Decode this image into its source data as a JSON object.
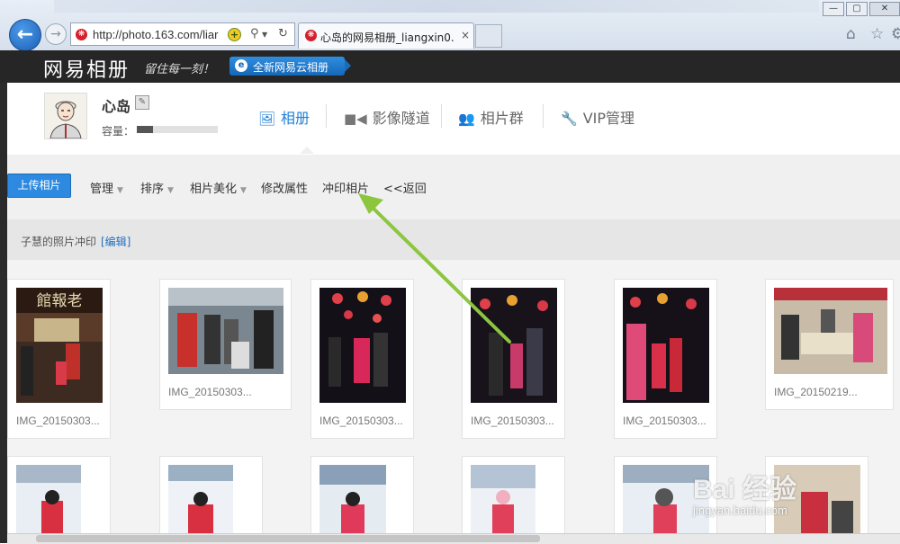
{
  "browser": {
    "url": "http://photo.163.com/liar",
    "tab_title": "心岛的网易相册_liangxin0...",
    "tab_close": "×",
    "back_glyph": "←",
    "forward_glyph": "→"
  },
  "header": {
    "logo": "网易相册",
    "slogan": "留住每一刻！",
    "promo_button": "全新网易云相册"
  },
  "profile": {
    "name": "心岛",
    "capacity_label": "容量：",
    "capacity_fraction": 0.2
  },
  "main_tabs": [
    {
      "label": "相册",
      "icon": "image-icon"
    },
    {
      "label": "影像隧道",
      "icon": "video-icon"
    },
    {
      "label": "相片群",
      "icon": "group-icon"
    },
    {
      "label": "VIP管理",
      "icon": "wrench-icon"
    }
  ],
  "toolbar": {
    "upload": "上传相片",
    "manage": "管理",
    "sort": "排序",
    "beautify": "相片美化",
    "edit_props": "修改属性",
    "print": "冲印相片",
    "back": "<<返回"
  },
  "album": {
    "name": "子慧的照片冲印",
    "edit_link": "[编辑]"
  },
  "photos": [
    {
      "caption": "IMG_20150303..."
    },
    {
      "caption": "IMG_20150303..."
    },
    {
      "caption": "IMG_20150303..."
    },
    {
      "caption": "IMG_20150303..."
    },
    {
      "caption": "IMG_20150303..."
    },
    {
      "caption": "IMG_20150219..."
    }
  ],
  "watermark": {
    "text": "Bai 经验",
    "url": "jingyan.baidu.com"
  },
  "colors": {
    "accent": "#1f7fd6",
    "upload_button": "#2d8ae0",
    "header_bar": "#262626",
    "arrow": "#8cc63f"
  }
}
